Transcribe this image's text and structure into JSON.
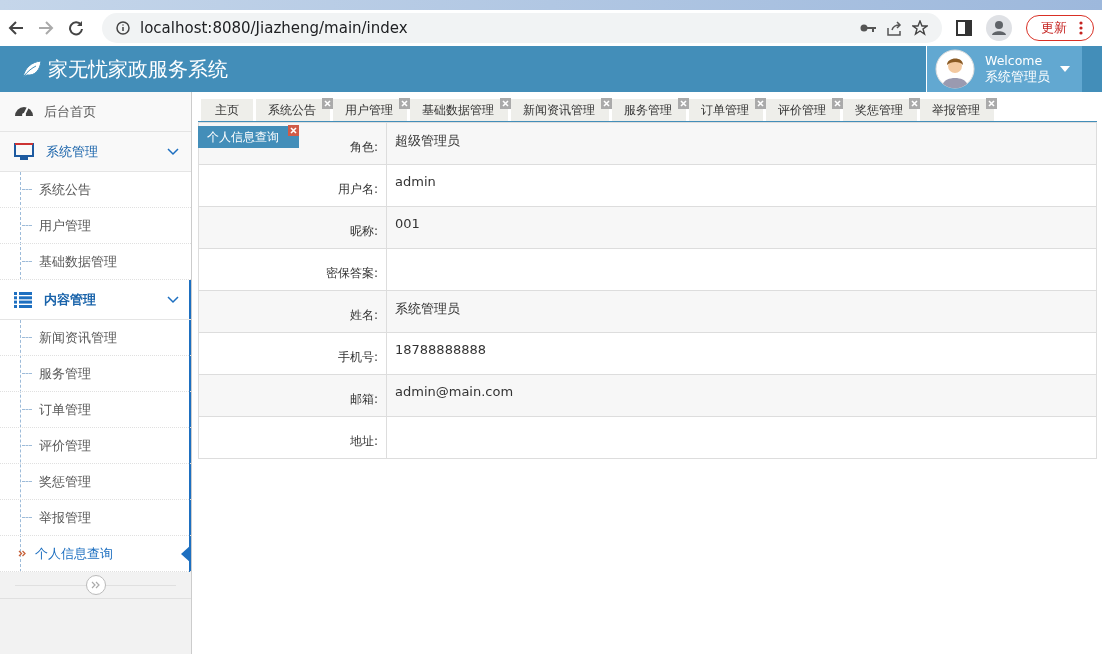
{
  "browser": {
    "url": "localhost:8080/Jiazheng/main/index",
    "update_button": "更新"
  },
  "header": {
    "title": "家无忧家政服务系统",
    "welcome": "Welcome",
    "user": "系统管理员"
  },
  "sidebar": {
    "items": [
      {
        "kind": "link",
        "label": "后台首页"
      },
      {
        "kind": "group",
        "label": "系统管理",
        "expanded": true,
        "active": false,
        "children": [
          {
            "label": "系统公告",
            "selected": false
          },
          {
            "label": "用户管理",
            "selected": false
          },
          {
            "label": "基础数据管理",
            "selected": false
          }
        ]
      },
      {
        "kind": "group",
        "label": "内容管理",
        "expanded": true,
        "active": true,
        "children": [
          {
            "label": "新闻资讯管理",
            "selected": false
          },
          {
            "label": "服务管理",
            "selected": false
          },
          {
            "label": "订单管理",
            "selected": false
          },
          {
            "label": "评价管理",
            "selected": false
          },
          {
            "label": "奖惩管理",
            "selected": false
          },
          {
            "label": "举报管理",
            "selected": false
          },
          {
            "label": "个人信息查询",
            "selected": true
          }
        ]
      }
    ]
  },
  "tabs": [
    {
      "label": "主页",
      "closable": false,
      "selected": false
    },
    {
      "label": "系统公告",
      "closable": true,
      "selected": false
    },
    {
      "label": "用户管理",
      "closable": true,
      "selected": false
    },
    {
      "label": "基础数据管理",
      "closable": true,
      "selected": false
    },
    {
      "label": "新闻资讯管理",
      "closable": true,
      "selected": false
    },
    {
      "label": "服务管理",
      "closable": true,
      "selected": false
    },
    {
      "label": "订单管理",
      "closable": true,
      "selected": false
    },
    {
      "label": "评价管理",
      "closable": true,
      "selected": false
    },
    {
      "label": "奖惩管理",
      "closable": true,
      "selected": false
    },
    {
      "label": "举报管理",
      "closable": true,
      "selected": false
    },
    {
      "label": "个人信息查询",
      "closable": true,
      "selected": true
    }
  ],
  "profile": {
    "rows": [
      {
        "label": "角色:",
        "value": "超级管理员"
      },
      {
        "label": "用户名:",
        "value": "admin"
      },
      {
        "label": "昵称:",
        "value": "001"
      },
      {
        "label": "密保答案:",
        "value": ""
      },
      {
        "label": "姓名:",
        "value": "系统管理员"
      },
      {
        "label": "手机号:",
        "value": "18788888888"
      },
      {
        "label": "邮箱:",
        "value": "admin@main.com"
      },
      {
        "label": "地址:",
        "value": ""
      }
    ]
  }
}
